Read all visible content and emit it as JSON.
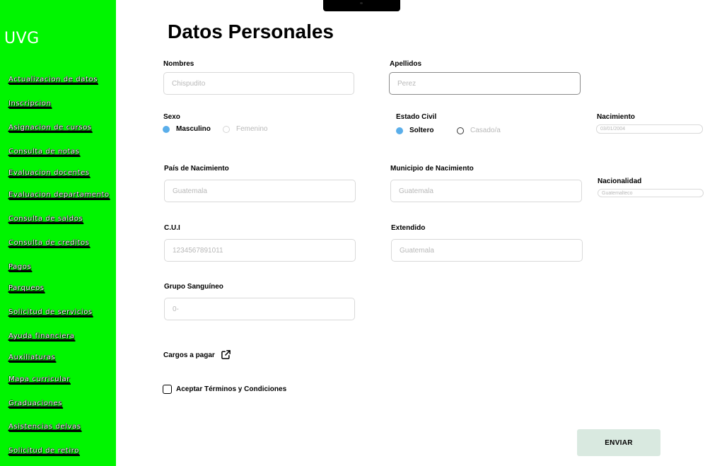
{
  "sidebar": {
    "brand": "UVG",
    "items": [
      {
        "label": "Actualizacion de datos"
      },
      {
        "label": "Inscripcion"
      },
      {
        "label": "Asignacion de cursos"
      },
      {
        "label": "Consulta de notas"
      },
      {
        "label": "Evaluacion docentes"
      },
      {
        "label": "Evaluacion departamento"
      },
      {
        "label": "Consulta de saldos"
      },
      {
        "label": "Consulta de creditos"
      },
      {
        "label": "Pagos"
      },
      {
        "label": "Parqueos"
      },
      {
        "label": "Solicitud de servicios"
      },
      {
        "label": "Ayuda financiera"
      },
      {
        "label": "Auxiliaturas"
      },
      {
        "label": "Mapa curricular"
      },
      {
        "label": "Graduaciones"
      },
      {
        "label": "Asistencias delvas"
      },
      {
        "label": "Solicitud de retiro"
      }
    ]
  },
  "form": {
    "title": "Datos Personales",
    "nombres": {
      "label": "Nombres",
      "placeholder": "Chispudito"
    },
    "apellidos": {
      "label": "Apellidos",
      "placeholder": "Perez"
    },
    "sexo": {
      "label": "Sexo",
      "option_male": "Masculino",
      "option_female": "Femenino",
      "selected": "Masculino"
    },
    "estado_civil": {
      "label": "Estado Civil",
      "option_single": "Soltero",
      "option_married": "Casado/a",
      "selected": "Soltero"
    },
    "nacimiento": {
      "label": "Nacimiento",
      "placeholder": "03/01/2004"
    },
    "pais": {
      "label": "País de Nacimiento",
      "placeholder": "Guatemala"
    },
    "municipio": {
      "label": "Municipio de Nacimiento",
      "placeholder": "Guatemala"
    },
    "nacionalidad": {
      "label": "Nacionalidad",
      "placeholder": "Guatemalteco"
    },
    "cui": {
      "label": "C.U.I",
      "placeholder": "1234567891011"
    },
    "extendido": {
      "label": "Extendido",
      "placeholder": "Guatemala"
    },
    "grupo": {
      "label": "Grupo Sanguíneo",
      "placeholder": "0-"
    },
    "cargos": {
      "label": "Cargos a pagar",
      "icon": "external-link-icon"
    },
    "terminos": {
      "label": "Aceptar Términos y Condiciones",
      "checked": false
    },
    "submit_label": "ENVIAR"
  },
  "colors": {
    "sidebar_bg": "#00f500",
    "radio_selected": "#5aaeea",
    "submit_bg": "#d9e9e0"
  }
}
